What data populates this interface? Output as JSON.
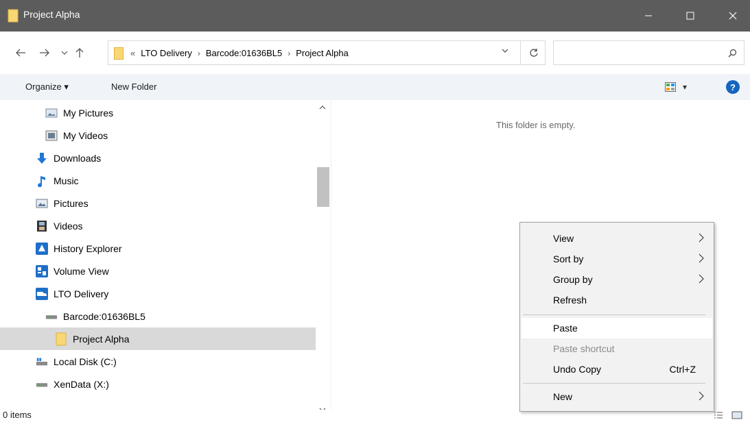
{
  "window": {
    "title": "Project Alpha",
    "controls": {
      "minimize": "—",
      "maximize": "☐",
      "close": "✕"
    }
  },
  "nav": {
    "back": "←",
    "forward": "→",
    "recent": "⌄",
    "up": "↑",
    "breadcrumb": [
      "«",
      "LTO Delivery",
      "Barcode:01636BL5",
      "Project Alpha"
    ],
    "separator": "›",
    "address_dropdown": "⌄",
    "refresh": "↻",
    "search_placeholder": ""
  },
  "command_bar": {
    "organize": "Organize ▾",
    "new_folder": "New Folder",
    "view_dropdown": "▾",
    "help": "?"
  },
  "tree": [
    {
      "label": "My Pictures",
      "icon": "library-pictures-icon"
    },
    {
      "label": "My Videos",
      "icon": "library-videos-icon"
    },
    {
      "label": "Downloads",
      "icon": "download-arrow-icon"
    },
    {
      "label": "Music",
      "icon": "music-note-icon"
    },
    {
      "label": "Pictures",
      "icon": "pictures-icon"
    },
    {
      "label": "Videos",
      "icon": "film-icon"
    },
    {
      "label": "History Explorer",
      "icon": "history-explorer-icon"
    },
    {
      "label": "Volume View",
      "icon": "volume-view-icon"
    },
    {
      "label": "LTO Delivery",
      "icon": "lto-delivery-icon"
    },
    {
      "label": "Barcode:01636BL5",
      "icon": "tape-drive-icon"
    },
    {
      "label": "Project Alpha",
      "icon": "folder-icon"
    },
    {
      "label": "Local Disk (C:)",
      "icon": "local-disk-icon"
    },
    {
      "label": "XenData (X:)",
      "icon": "network-drive-icon"
    }
  ],
  "scroll": {
    "up": "^",
    "down": "⌄"
  },
  "content": {
    "empty_message": "This folder is empty."
  },
  "status": {
    "count": "0 items"
  },
  "context_menu": {
    "items": [
      {
        "label": "View",
        "submenu": true
      },
      {
        "label": "Sort by",
        "submenu": true
      },
      {
        "label": "Group by",
        "submenu": true
      },
      {
        "label": "Refresh",
        "submenu": false
      },
      {
        "label": "Paste",
        "submenu": false
      },
      {
        "label": "Paste shortcut",
        "submenu": false,
        "disabled": true
      },
      {
        "label": "Undo Copy",
        "submenu": false,
        "shortcut": "Ctrl+Z"
      },
      {
        "label": "New",
        "submenu": true
      }
    ],
    "arrow": "›"
  },
  "colors": {
    "titlebar": "#5c5c5c",
    "folder": "#f8d775",
    "selection": "#d9d9d9",
    "accent": "#1565c0"
  }
}
